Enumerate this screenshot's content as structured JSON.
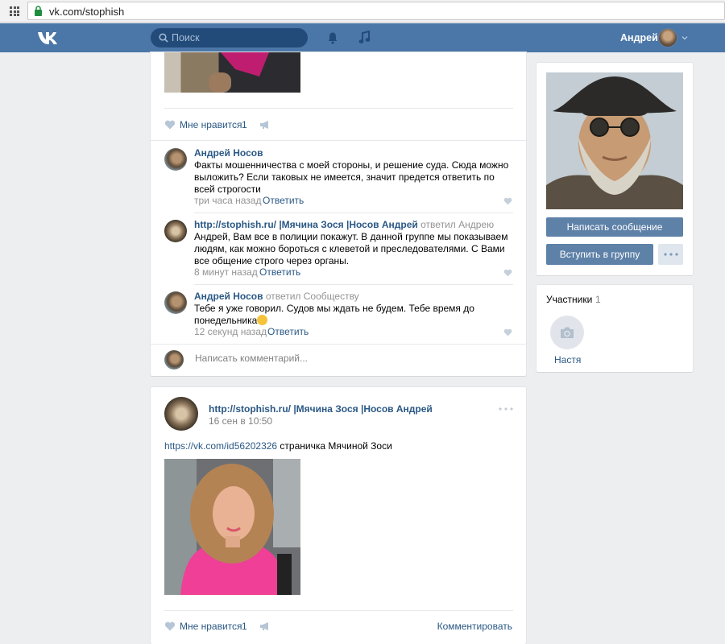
{
  "browser": {
    "url": "vk.com/stophish"
  },
  "header": {
    "search_placeholder": "Поиск",
    "user_name": "Андрей"
  },
  "post1": {
    "likes": {
      "label": "Мне нравится",
      "count": "1"
    },
    "comments": [
      {
        "author": "Андрей Носов",
        "note": "",
        "text": "Факты мошенничества с моей стороны, и решение суда. Сюда можно выложить? Если таковых не имеется, значит предется ответить по всей строгости",
        "time": "три часа назад",
        "reply": "Ответить"
      },
      {
        "author": "http://stophish.ru/ |Мячина Зося |Носов Андрей",
        "note": "ответил Андрею",
        "text": "Андрей, Вам все в полиции покажут. В данной группе мы показываем людям, как можно бороться с клеветой и преследователями. С Вами все общение строго через органы.",
        "time": "8 минут назад",
        "reply": "Ответить"
      },
      {
        "author": "Андрей Носов",
        "note": "ответил Сообществу",
        "text": "Тебе я уже говорил. Судов мы ждать не будем. Тебе время до понедельника",
        "time": "12 секунд назад",
        "reply": "Ответить"
      }
    ],
    "write_placeholder": "Написать комментарий..."
  },
  "post2": {
    "author": "http://stophish.ru/ |Мячина Зося |Носов Андрей",
    "date": "16 сен в 10:50",
    "link": "https://vk.com/id56202326",
    "text": " страничка Мячиной Зоси",
    "likes": {
      "label": "Мне нравится",
      "count": "1"
    },
    "comment_label": "Комментировать"
  },
  "sidebar": {
    "write_message": "Написать сообщение",
    "join_group": "Вступить в группу",
    "members": {
      "title": "Участники",
      "count": "1",
      "items": [
        {
          "name": "Настя"
        }
      ]
    }
  },
  "colors": {
    "header": "#4a76a8",
    "link": "#2a5885",
    "button": "#5e81a8",
    "background": "#edeef0"
  }
}
